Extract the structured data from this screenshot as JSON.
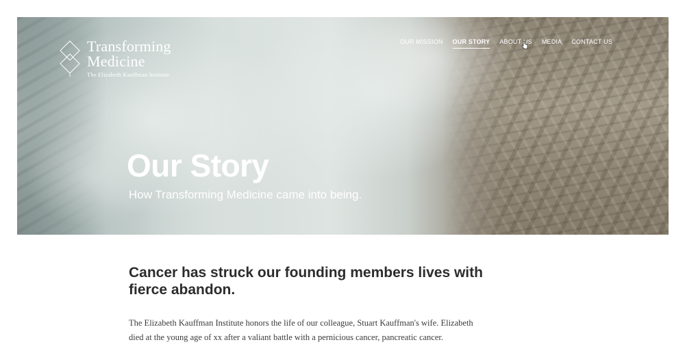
{
  "logo": {
    "line1": "Transforming",
    "line2": "Medicine",
    "subtitle": "The Elizabeth Kauffman Institute"
  },
  "nav": {
    "items": [
      {
        "label": "OUR MISSION",
        "active": false
      },
      {
        "label": "OUR STORY",
        "active": true
      },
      {
        "label": "ABOUT US",
        "active": false
      },
      {
        "label": "MEDIA",
        "active": false
      },
      {
        "label": "CONTACT US",
        "active": false
      }
    ]
  },
  "hero": {
    "title": "Our Story",
    "subtitle": "How Transforming Medicine came into being."
  },
  "content": {
    "heading": "Cancer has struck our founding members lives with fierce abandon.",
    "paragraph": "The Elizabeth Kauffman Institute honors the life of our colleague, Stuart Kauffman's wife. Elizabeth died at the young age of xx after a valiant battle with a pernicious cancer, pancreatic cancer."
  },
  "colors": {
    "text_dark": "#2c2c2c",
    "hero_text": "#ffffff"
  }
}
